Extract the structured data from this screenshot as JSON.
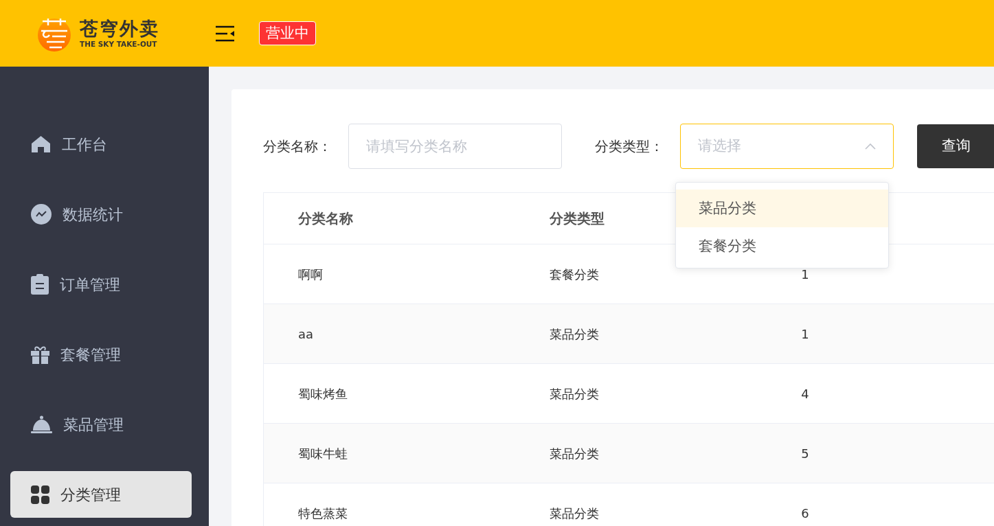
{
  "header": {
    "brand": "苍穹外卖",
    "brand_subtitle": "THE SKY TAKE-OUT",
    "status_badge": "营业中"
  },
  "sidebar": {
    "items": [
      {
        "label": "工作台",
        "kind": "home",
        "selected": false
      },
      {
        "label": "数据统计",
        "kind": "chart",
        "selected": false
      },
      {
        "label": "订单管理",
        "kind": "clipboard",
        "selected": false
      },
      {
        "label": "套餐管理",
        "kind": "gift",
        "selected": false
      },
      {
        "label": "菜品管理",
        "kind": "cloche",
        "selected": false
      },
      {
        "label": "分类管理",
        "kind": "grid",
        "selected": true
      }
    ]
  },
  "filters": [
    {
      "label": "分类名称：",
      "kind": "text",
      "placeholder": "请填写分类名称"
    },
    {
      "label": "分类类型：",
      "kind": "select",
      "placeholder": "请选择",
      "expanded": true
    }
  ],
  "query_button": "查询",
  "dropdown": {
    "options": [
      {
        "label": "菜品分类",
        "highlighted": true
      },
      {
        "label": "套餐分类",
        "highlighted": false
      }
    ]
  },
  "table": {
    "columns": [
      "分类名称",
      "分类类型"
    ],
    "rows": [
      {
        "cells": [
          "啊啊",
          "套餐分类",
          "1"
        ]
      },
      {
        "cells": [
          "aa",
          "菜品分类",
          "1"
        ]
      },
      {
        "cells": [
          "蜀味烤鱼",
          "菜品分类",
          "4"
        ]
      },
      {
        "cells": [
          "蜀味牛蛙",
          "菜品分类",
          "5"
        ]
      },
      {
        "cells": [
          "特色蒸菜",
          "菜品分类",
          "6"
        ]
      }
    ]
  }
}
